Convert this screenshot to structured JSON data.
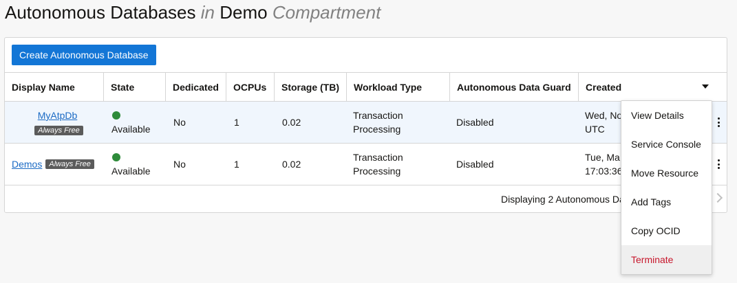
{
  "header": {
    "title_main": "Autonomous Databases",
    "title_in": "in",
    "compartment_name": "Demo",
    "compartment_word": "Compartment"
  },
  "toolbar": {
    "create_label": "Create Autonomous Database"
  },
  "table": {
    "columns": [
      "Display Name",
      "State",
      "Dedicated",
      "OCPUs",
      "Storage (TB)",
      "Workload Type",
      "Autonomous Data Guard",
      "Created"
    ],
    "rows": [
      {
        "display_name": "MyAtpDb",
        "badge": "Always Free",
        "state": "Available",
        "dedicated": "No",
        "ocpus": "1",
        "storage": "0.02",
        "workload_line1": "Transaction",
        "workload_line2": "Processing",
        "data_guard": "Disabled",
        "created_line1": "Wed, No",
        "created_line2": "UTC"
      },
      {
        "display_name": "Demos",
        "badge": "Always Free",
        "state": "Available",
        "dedicated": "No",
        "ocpus": "1",
        "storage": "0.02",
        "workload_line1": "Transaction",
        "workload_line2": "Processing",
        "data_guard": "Disabled",
        "created_line1": "Tue, Ma",
        "created_line2": "17:03:36"
      }
    ],
    "footer_text": "Displaying 2 Autonomous Da"
  },
  "menu": {
    "items": [
      "View Details",
      "Service Console",
      "Move Resource",
      "Add Tags",
      "Copy OCID",
      "Terminate"
    ]
  },
  "colors": {
    "primary": "#1376d6",
    "link": "#1a6ac4",
    "available": "#2e8b3a",
    "danger": "#c7162b"
  }
}
